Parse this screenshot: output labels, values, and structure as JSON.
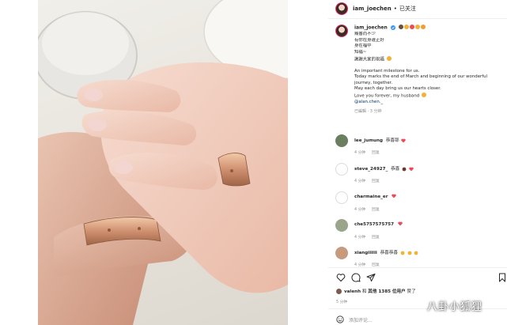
{
  "post": {
    "username": "iam_joechen",
    "follow_status": "已关注",
    "caption": {
      "lines": [
        "幾番而不少",
        "有你在身邊正好",
        "身在福中",
        "知福~",
        "謝謝大家的祝福"
      ],
      "english": [
        "An important milestone for us.",
        "Today marks the end of March and beginning of our wonderful",
        "journey, together.",
        "May each day bring us our hearts closer.",
        "Love you forever, my husband"
      ],
      "mention": "@alan.chen._",
      "meta": "已編輯 · 3 分钟"
    }
  },
  "comments": [
    {
      "user": "lee_jumung",
      "text": "恭喜耶",
      "time": "4 分钟",
      "reply": "回复",
      "avatar_color": "#6b7f5e"
    },
    {
      "user": "steve_24927_",
      "text": "恭喜",
      "time": "4 分钟",
      "reply": "回复",
      "avatar_color": "#ffffff"
    },
    {
      "user": "charmaine_er",
      "text": "",
      "time": "4 分钟",
      "reply": "回复",
      "avatar_color": "#ffffff"
    },
    {
      "user": "che5757575757",
      "text": "",
      "time": "4 分钟",
      "reply": "回复",
      "avatar_color": "#9aa58a"
    },
    {
      "user": "xiangiiiiii",
      "text": "恭喜恭喜",
      "time": "4 分钟",
      "reply": "回复",
      "avatar_color": "#c79a7e"
    }
  ],
  "likes": {
    "liker": "valenh",
    "text_mid": "和",
    "others": "其他 1385 位用户",
    "text_end": "赞了"
  },
  "post_time": "5 分钟",
  "add_comment_placeholder": "添加评论...",
  "watermark": "八卦小狐狸",
  "colors": {
    "heart": "#ed4956",
    "link": "#00376b",
    "muted": "#8e8e8e",
    "ring_gold": "#d9a27b"
  },
  "icons": [
    "more-icon",
    "verified-icon",
    "heart-icon",
    "comment-icon",
    "share-icon",
    "bookmark-icon",
    "emoji-icon"
  ]
}
